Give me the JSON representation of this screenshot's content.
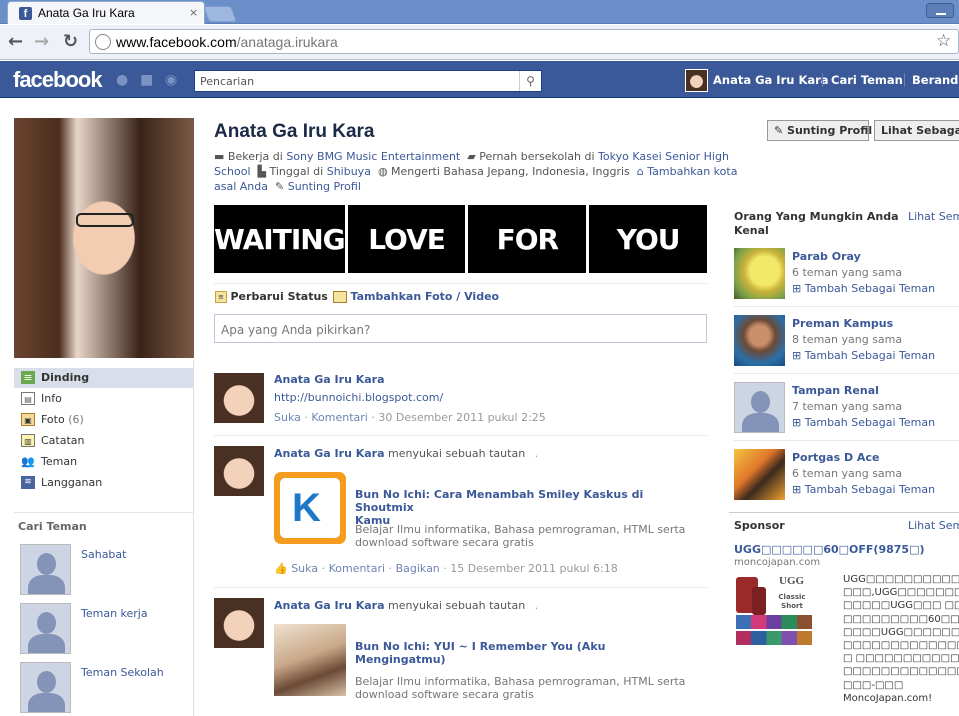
{
  "browser": {
    "tab_title": "Anata Ga Iru Kara",
    "tab_close": "×",
    "url_host": "www.facebook.com",
    "url_path": "/anataga.irukara",
    "back": "←",
    "forward": "→",
    "reload": "↻",
    "star": "☆"
  },
  "fb": {
    "logo": "facebook",
    "search_placeholder": "Pencarian",
    "user_name": "Anata Ga Iru Kara",
    "find_friends": "Cari Teman",
    "home": "Beranda"
  },
  "profile": {
    "name": "Anata Ga Iru Kara",
    "work_prefix": "Bekerja di",
    "work": "Sony BMG Music Entertainment",
    "school_prefix": "Pernah bersekolah di",
    "school_1": "Tokyo Kasei Senior High",
    "school_2": "School",
    "live_prefix": "Tinggal di",
    "live": "Shibuya",
    "lang_prefix": "Mengerti Bahasa",
    "lang": "Jepang, Indonesia, Inggris",
    "add_city_1": "Tambahkan kota",
    "add_city_2": "asal Anda",
    "edit_profile_link": "Sunting Profil",
    "edit_profile_btn": "Sunting Profil",
    "view_as_btn": "Lihat Sebagai..."
  },
  "banner": [
    "WAITING",
    "LOVE",
    "FOR",
    "YOU"
  ],
  "composer": {
    "update_status": "Perbarui Status",
    "add_photo": "Tambahkan Foto / Video",
    "placeholder": "Apa yang Anda pikirkan?"
  },
  "left_nav": [
    {
      "label": "Dinding",
      "count": ""
    },
    {
      "label": "Info",
      "count": ""
    },
    {
      "label": "Foto",
      "count": "(6)"
    },
    {
      "label": "Catatan",
      "count": ""
    },
    {
      "label": "Teman",
      "count": ""
    },
    {
      "label": "Langganan",
      "count": ""
    }
  ],
  "find_friends": {
    "title": "Cari Teman",
    "items": [
      "Sahabat",
      "Teman kerja",
      "Teman Sekolah"
    ]
  },
  "stories": [
    {
      "author": "Anata Ga Iru Kara",
      "action": "",
      "text": "http://bunnoichi.blogspot.com/",
      "like": "Suka",
      "comment": "Komentari",
      "share": "",
      "time": "30 Desember 2011 pukul 2:25"
    },
    {
      "author": "Anata Ga Iru Kara",
      "action": "menyukai sebuah tautan",
      "dot": ".",
      "link_title_1": "Bun No Ichi: Cara Menambah Smiley Kaskus di Shoutmix",
      "link_title_2": "Kamu",
      "desc_1": "Belajar Ilmu informatika, Bahasa pemrograman, HTML serta",
      "desc_2": "download software secara gratis",
      "like": "Suka",
      "comment": "Komentari",
      "share": "Bagikan",
      "time": "15 Desember 2011 pukul 6:18"
    },
    {
      "author": "Anata Ga Iru Kara",
      "action": "menyukai sebuah tautan",
      "dot": ".",
      "link_title_1": "Bun No Ichi: YUI ~ I Remember You (Aku",
      "link_title_2": "Mengingatmu)",
      "desc_1": "Belajar Ilmu informatika, Bahasa pemrograman, HTML serta",
      "desc_2": "download software secara gratis"
    }
  ],
  "pymk": {
    "title_1": "Orang Yang Mungkin Anda",
    "title_2": "Kenal",
    "see_all": "Lihat Semua",
    "people": [
      {
        "name": "Parab Oray",
        "mutual": "6 teman yang sama",
        "add": "Tambah Sebagai Teman"
      },
      {
        "name": "Preman Kampus",
        "mutual": "8 teman yang sama",
        "add": "Tambah Sebagai Teman"
      },
      {
        "name": "Tampan Renal",
        "mutual": "7 teman yang sama",
        "add": "Tambah Sebagai Teman"
      },
      {
        "name": "Portgas D Ace",
        "mutual": "6 teman yang sama",
        "add": "Tambah Sebagai Teman"
      }
    ]
  },
  "sponsor": {
    "title": "Sponsor",
    "see_all": "Lihat Semua",
    "ad_title": "UGG□□□□□□60□OFF(9875□)",
    "ad_domain": "moncojapan.com",
    "ad_text": [
      "UGG□□□□□□□□□□□",
      "□□□,UGG□□□□□□□",
      "□□□□□UGG□□□ □□",
      "□□□□□□□□□60□□",
      "□□□□UGG□□□□□□□",
      "□□□□□□□□□□□□□□",
      "□ □□□□□□□□□□□□",
      "□□□□□□□□□□□□□□",
      "□□□-□□□"
    ],
    "ad_footer": "MoncoJapan.com!",
    "ugg_brand": "UGG",
    "ugg_model": "Classic Short"
  }
}
